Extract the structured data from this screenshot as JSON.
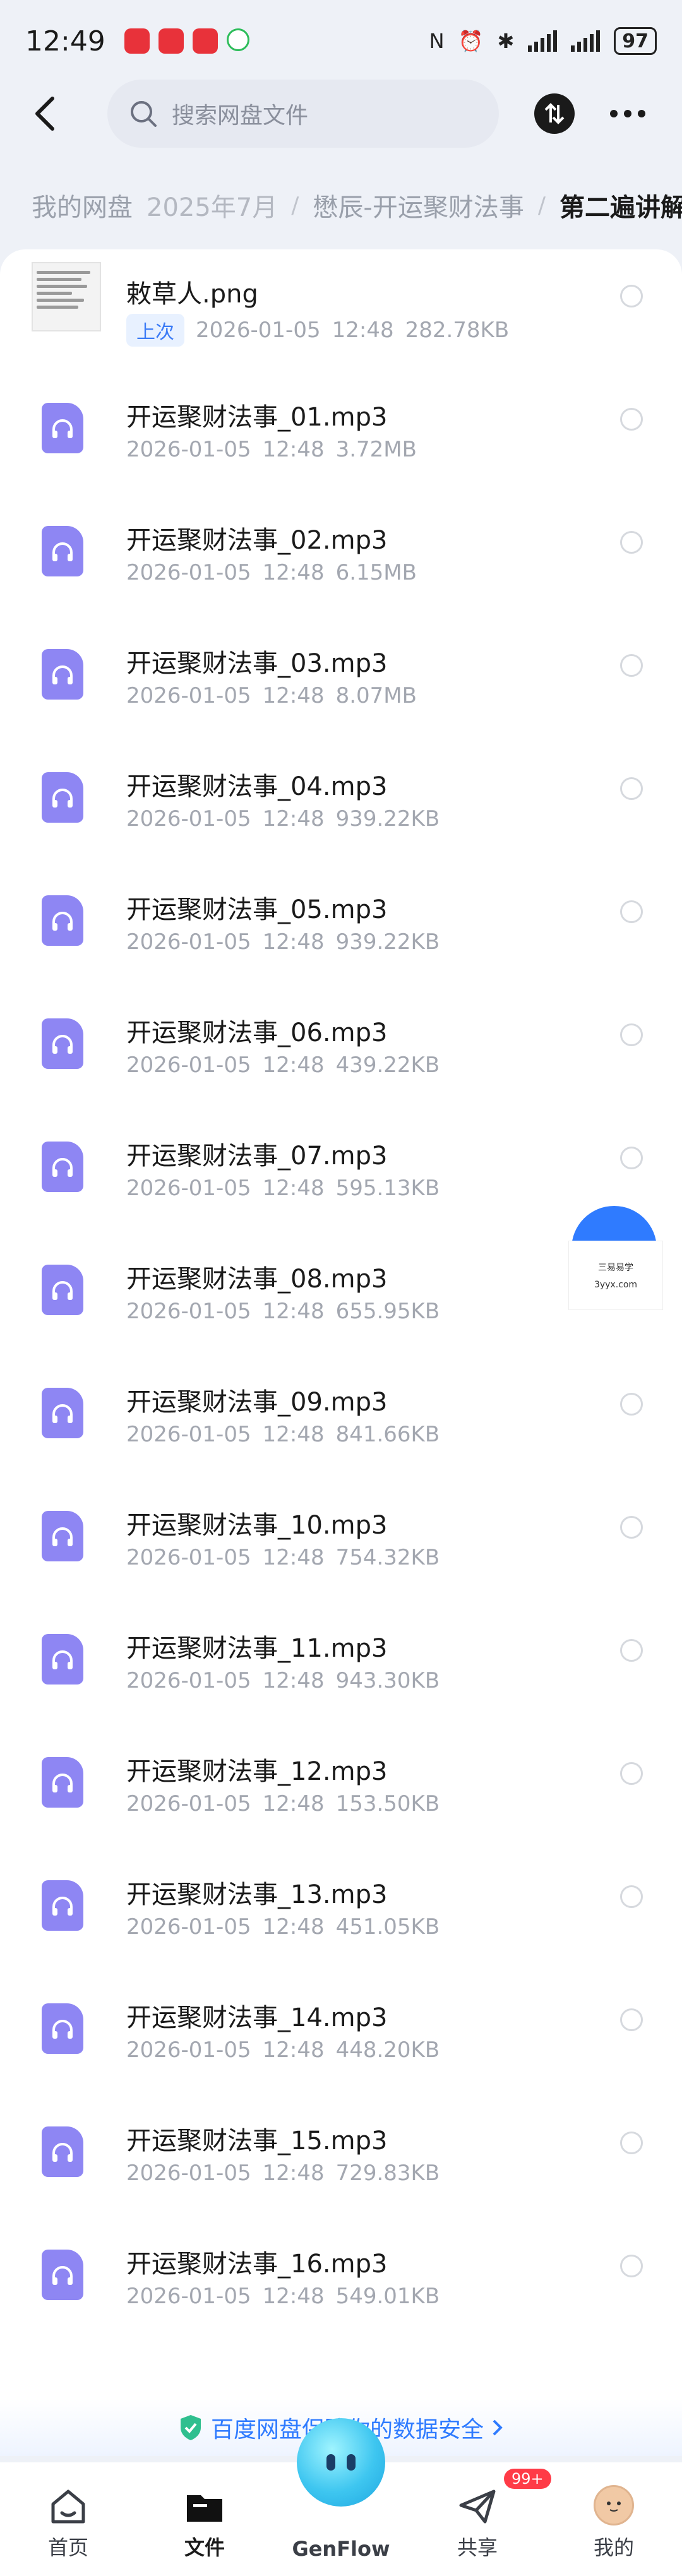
{
  "status_bar": {
    "time": "12:49",
    "battery": "97"
  },
  "search": {
    "placeholder": "搜索网盘文件"
  },
  "breadcrumb": [
    {
      "label": "我的网盘"
    },
    {
      "label": "2025年7月"
    },
    {
      "label": "懋辰-开运聚财法事"
    },
    {
      "label": "第二遍讲解"
    }
  ],
  "files": [
    {
      "name": "敕草人.png",
      "date": "2026-01-05",
      "time": "12:48",
      "size": "282.78KB",
      "badge": "上次",
      "type": "image"
    },
    {
      "name": "开运聚财法事_01.mp3",
      "date": "2026-01-05",
      "time": "12:48",
      "size": "3.72MB",
      "type": "audio"
    },
    {
      "name": "开运聚财法事_02.mp3",
      "date": "2026-01-05",
      "time": "12:48",
      "size": "6.15MB",
      "type": "audio"
    },
    {
      "name": "开运聚财法事_03.mp3",
      "date": "2026-01-05",
      "time": "12:48",
      "size": "8.07MB",
      "type": "audio"
    },
    {
      "name": "开运聚财法事_04.mp3",
      "date": "2026-01-05",
      "time": "12:48",
      "size": "939.22KB",
      "type": "audio"
    },
    {
      "name": "开运聚财法事_05.mp3",
      "date": "2026-01-05",
      "time": "12:48",
      "size": "939.22KB",
      "type": "audio"
    },
    {
      "name": "开运聚财法事_06.mp3",
      "date": "2026-01-05",
      "time": "12:48",
      "size": "439.22KB",
      "type": "audio"
    },
    {
      "name": "开运聚财法事_07.mp3",
      "date": "2026-01-05",
      "time": "12:48",
      "size": "595.13KB",
      "type": "audio"
    },
    {
      "name": "开运聚财法事_08.mp3",
      "date": "2026-01-05",
      "time": "12:48",
      "size": "655.95KB",
      "type": "audio"
    },
    {
      "name": "开运聚财法事_09.mp3",
      "date": "2026-01-05",
      "time": "12:48",
      "size": "841.66KB",
      "type": "audio"
    },
    {
      "name": "开运聚财法事_10.mp3",
      "date": "2026-01-05",
      "time": "12:48",
      "size": "754.32KB",
      "type": "audio"
    },
    {
      "name": "开运聚财法事_11.mp3",
      "date": "2026-01-05",
      "time": "12:48",
      "size": "943.30KB",
      "type": "audio"
    },
    {
      "name": "开运聚财法事_12.mp3",
      "date": "2026-01-05",
      "time": "12:48",
      "size": "153.50KB",
      "type": "audio"
    },
    {
      "name": "开运聚财法事_13.mp3",
      "date": "2026-01-05",
      "time": "12:48",
      "size": "451.05KB",
      "type": "audio"
    },
    {
      "name": "开运聚财法事_14.mp3",
      "date": "2026-01-05",
      "time": "12:48",
      "size": "448.20KB",
      "type": "audio"
    },
    {
      "name": "开运聚财法事_15.mp3",
      "date": "2026-01-05",
      "time": "12:48",
      "size": "729.83KB",
      "type": "audio"
    },
    {
      "name": "开运聚财法事_16.mp3",
      "date": "2026-01-05",
      "time": "12:48",
      "size": "549.01KB",
      "type": "audio"
    }
  ],
  "watermark": {
    "name": "三易易学",
    "site": "3yyx.com"
  },
  "safety_banner": {
    "text": "百度网盘保障你的数据安全"
  },
  "bottom_nav": {
    "home": "首页",
    "files": "文件",
    "genflow": "GenFlow",
    "share": "共享",
    "share_badge": "99+",
    "mine": "我的"
  },
  "colors": {
    "accent": "#2f7bff",
    "audio_icon": "#8e86f3",
    "badge_red": "#ff3b47"
  }
}
